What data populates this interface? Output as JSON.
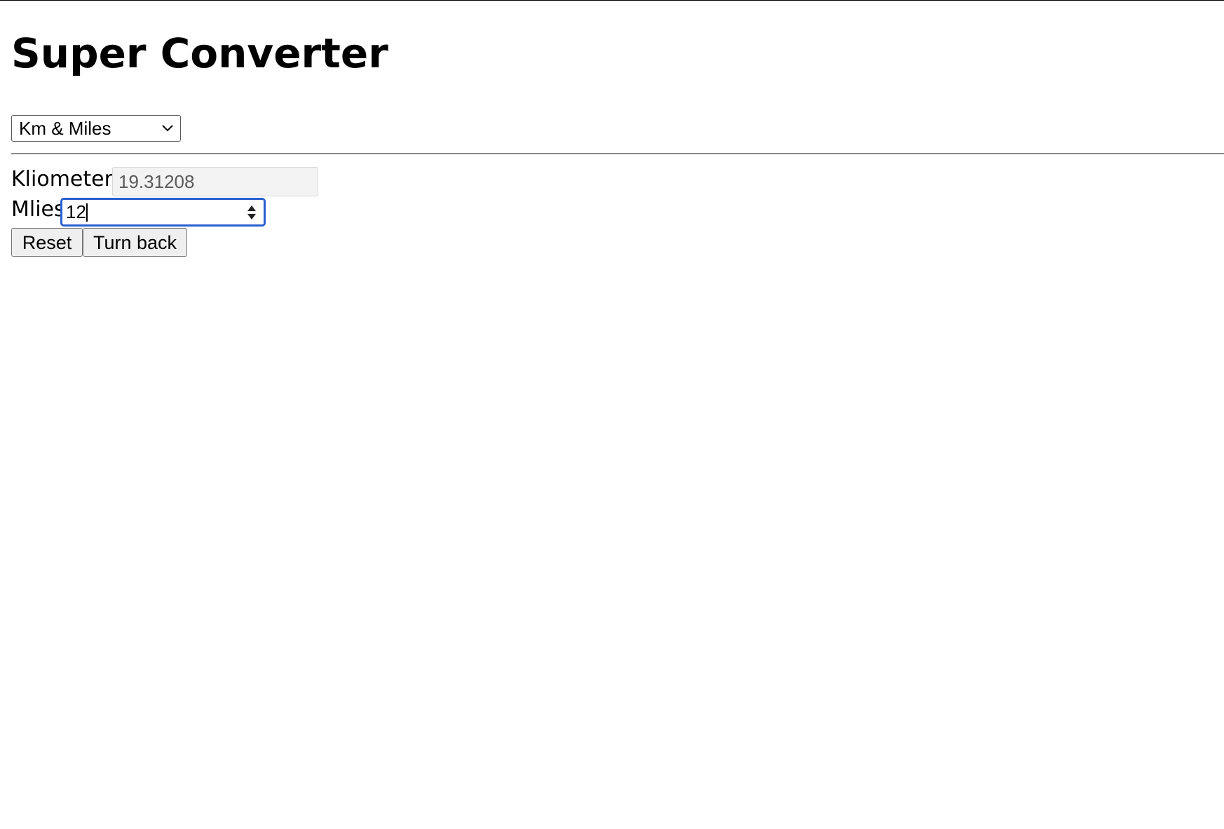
{
  "page": {
    "title": "Super Converter"
  },
  "converter": {
    "mode_select": {
      "selected": "Km & Miles",
      "icon": "chevron-down-icon"
    },
    "kilometers": {
      "label": "Kliometers",
      "value": "19.31208"
    },
    "miles": {
      "label": "Mlies",
      "value": "12",
      "spinner_icon": "stepper-arrows-icon"
    },
    "buttons": {
      "reset_label": "Reset",
      "back_label": "Turn back"
    }
  },
  "colors": {
    "focus_ring": "#2a5fd0",
    "readonly_bg": "#f3f3f3",
    "button_bg": "#efefef"
  }
}
